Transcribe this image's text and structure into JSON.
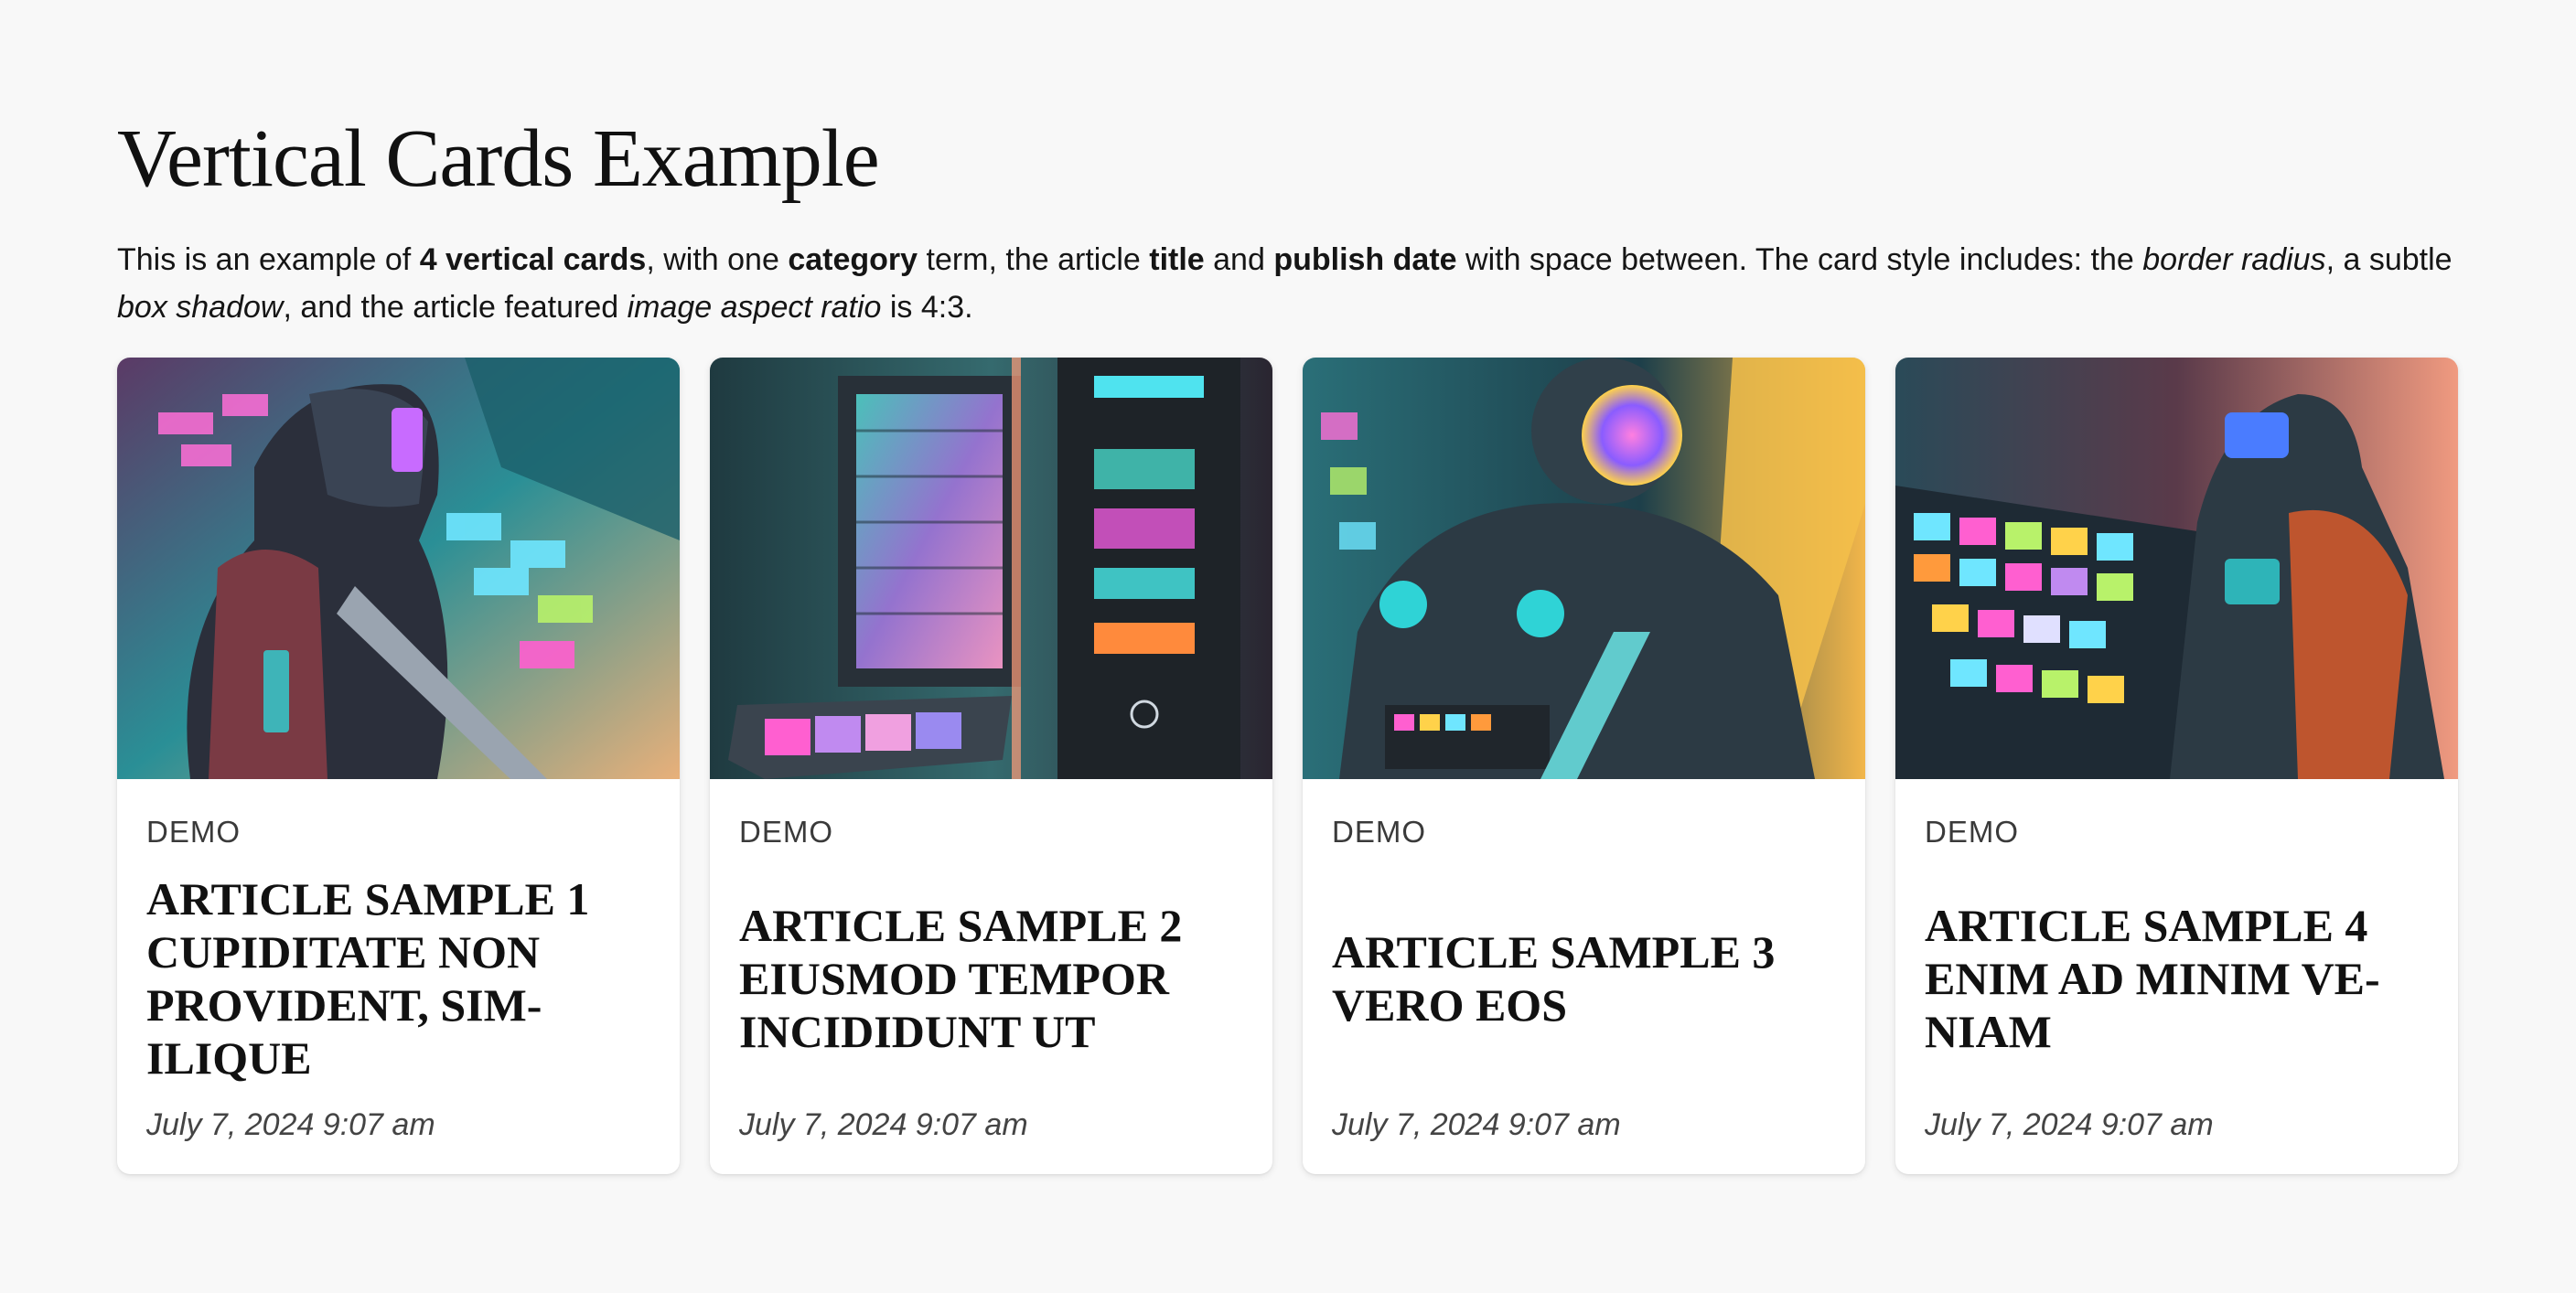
{
  "page": {
    "title": "Vertical Cards Example",
    "intro": {
      "p1": "This is an example of ",
      "b1": "4 vertical cards",
      "p2": ", with one ",
      "b2": "category",
      "p3": " term, the article ",
      "b3": "title",
      "p4": " and ",
      "b4": "publish date",
      "p5": " with space between. The card style includes: the ",
      "i1": "border radius",
      "p6": ", a subtle ",
      "i2": "box shadow",
      "p7": ", and the article featured ",
      "i3": "image aspect ratio",
      "p8": " is 4:3."
    }
  },
  "cards": [
    {
      "category": "DEMO",
      "title": "Article Sample 1 cupiditate non provident, sim-ilique",
      "date": "July 7, 2024 9:07 am",
      "image": "cyberpunk-robot-illustration"
    },
    {
      "category": "DEMO",
      "title": "Article Sample 2 eiusmod tempor incididunt ut",
      "date": "July 7, 2024 9:07 am",
      "image": "cyberpunk-machine-illustration"
    },
    {
      "category": "DEMO",
      "title": "Article Sample 3 vero eos",
      "date": "July 7, 2024 9:07 am",
      "image": "cyberpunk-robot-illustration"
    },
    {
      "category": "DEMO",
      "title": "Article Sample 4 enim ad minim ve-niam",
      "date": "July 7, 2024 9:07 am",
      "image": "cyberpunk-robot-illustration"
    }
  ],
  "colors": {
    "background": "#f8f8f8",
    "card": "#ffffff",
    "neon_teal": "#2fd3d6",
    "neon_pink": "#ff4fbf",
    "neon_orange": "#ff9a3c"
  }
}
